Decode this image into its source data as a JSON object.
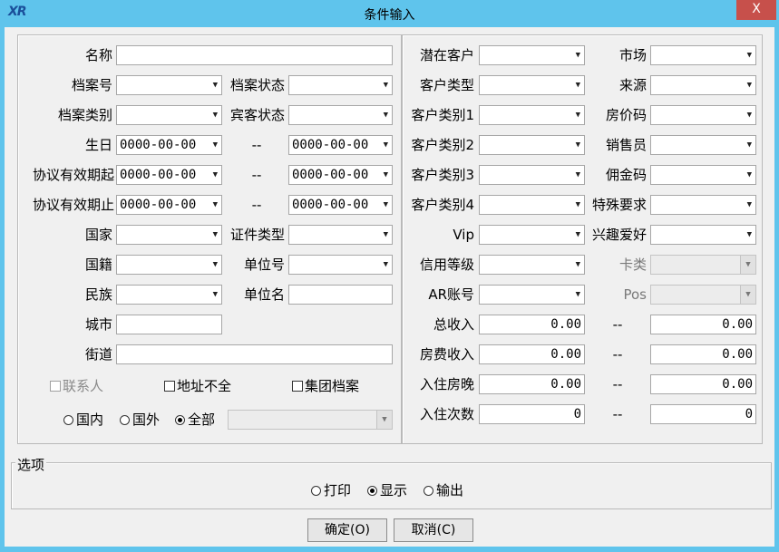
{
  "window": {
    "title": "条件输入",
    "logo": "XR",
    "close_glyph": "X"
  },
  "left": {
    "name_label": "名称",
    "name_value": "",
    "file_no_label": "档案号",
    "file_no_value": "",
    "file_status_label": "档案状态",
    "file_status_value": "",
    "file_type_label": "档案类别",
    "file_type_value": "",
    "guest_status_label": "宾客状态",
    "guest_status_value": "",
    "birthday_label": "生日",
    "birthday_from": "0000-00-00",
    "birthday_sep": "--",
    "birthday_to": "0000-00-00",
    "agreement_start_label": "协议有效期起",
    "agreement_start_from": "0000-00-00",
    "agreement_start_sep": "--",
    "agreement_start_to": "0000-00-00",
    "agreement_end_label": "协议有效期止",
    "agreement_end_from": "0000-00-00",
    "agreement_end_sep": "--",
    "agreement_end_to": "0000-00-00",
    "country_label": "国家",
    "country_value": "",
    "id_type_label": "证件类型",
    "id_type_value": "",
    "nationality_label": "国籍",
    "nationality_value": "",
    "company_no_label": "单位号",
    "company_no_value": "",
    "ethnicity_label": "民族",
    "ethnicity_value": "",
    "company_name_label": "单位名",
    "company_name_value": "",
    "city_label": "城市",
    "city_value": "",
    "street_label": "街道",
    "street_value": "",
    "contact_label": "联系人",
    "incomplete_address_label": "地址不全",
    "group_file_label": "集团档案",
    "scope_domestic": "国内",
    "scope_foreign": "国外",
    "scope_all": "全部",
    "scope_selected": "全部",
    "scope_combo_value": ""
  },
  "right": {
    "potential_label": "潜在客户",
    "potential_value": "",
    "market_label": "市场",
    "market_value": "",
    "customer_type_label": "客户类型",
    "customer_type_value": "",
    "source_label": "来源",
    "source_value": "",
    "customer_cat1_label": "客户类别1",
    "customer_cat1_value": "",
    "rate_code_label": "房价码",
    "rate_code_value": "",
    "customer_cat2_label": "客户类别2",
    "customer_cat2_value": "",
    "sales_label": "销售员",
    "sales_value": "",
    "customer_cat3_label": "客户类别3",
    "customer_cat3_value": "",
    "commission_label": "佣金码",
    "commission_value": "",
    "customer_cat4_label": "客户类别4",
    "customer_cat4_value": "",
    "special_req_label": "特殊要求",
    "special_req_value": "",
    "vip_label": "Vip",
    "vip_value": "",
    "hobby_label": "兴趣爱好",
    "hobby_value": "",
    "credit_label": "信用等级",
    "credit_value": "",
    "card_type_label": "卡类",
    "card_type_value": "",
    "ar_label": "AR账号",
    "ar_value": "",
    "pos_label": "Pos",
    "pos_value": "",
    "total_income_label": "总收入",
    "total_income_from": "0.00",
    "total_income_sep": "--",
    "total_income_to": "0.00",
    "room_income_label": "房费收入",
    "room_income_from": "0.00",
    "room_income_sep": "--",
    "room_income_to": "0.00",
    "nights_label": "入住房晚",
    "nights_from": "0.00",
    "nights_sep": "--",
    "nights_to": "0.00",
    "stays_label": "入住次数",
    "stays_from": "0",
    "stays_sep": "--",
    "stays_to": "0"
  },
  "options": {
    "group_label": "选项",
    "print_label": "打印",
    "display_label": "显示",
    "export_label": "输出",
    "selected": "显示"
  },
  "buttons": {
    "ok_label": "确定(O)",
    "cancel_label": "取消(C)"
  }
}
